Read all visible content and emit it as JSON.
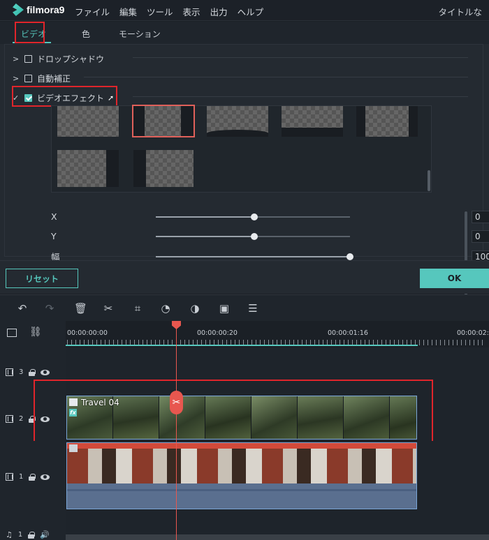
{
  "app": {
    "logo": "filmora9",
    "title_right": "タイトルな"
  },
  "menu": [
    "ファイル",
    "編集",
    "ツール",
    "表示",
    "出力",
    "ヘルプ"
  ],
  "tabs": [
    {
      "label": "ビデオ",
      "active": true
    },
    {
      "label": "色",
      "active": false
    },
    {
      "label": "モーション",
      "active": false
    }
  ],
  "sections": [
    {
      "label": "ドロップシャドウ",
      "checked": false,
      "expanded": false
    },
    {
      "label": "自動補正",
      "checked": false,
      "expanded": false
    },
    {
      "label": "ビデオエフェクト",
      "checked": true,
      "expanded": true
    }
  ],
  "sliders": [
    {
      "label": "X",
      "value": "0",
      "position": 0.5
    },
    {
      "label": "Y",
      "value": "0",
      "position": 0.5
    },
    {
      "label": "幅",
      "value": "100",
      "position": 1.0
    }
  ],
  "buttons": {
    "reset": "リセット",
    "ok": "OK"
  },
  "toolbar_icons": [
    "undo-icon",
    "redo-icon",
    "delete-icon",
    "cut-icon",
    "crop-icon",
    "speed-icon",
    "color-icon",
    "green-screen-icon",
    "audio-adjust-icon"
  ],
  "ruler": {
    "t0": "00:00:00:00",
    "t1": "00:00:00:20",
    "t2": "00:00:01:16",
    "t3": "00:00:02:"
  },
  "tracks": [
    {
      "label": "3",
      "type": "video"
    },
    {
      "label": "2",
      "type": "video"
    },
    {
      "label": "1",
      "type": "video"
    },
    {
      "label": "1",
      "type": "audio"
    }
  ],
  "clips": {
    "track2_title": "Travel 04",
    "fx": "fx"
  },
  "colors": {
    "accent": "#56c7bd",
    "playhead": "#e8574f",
    "highlight": "#e0252b"
  }
}
